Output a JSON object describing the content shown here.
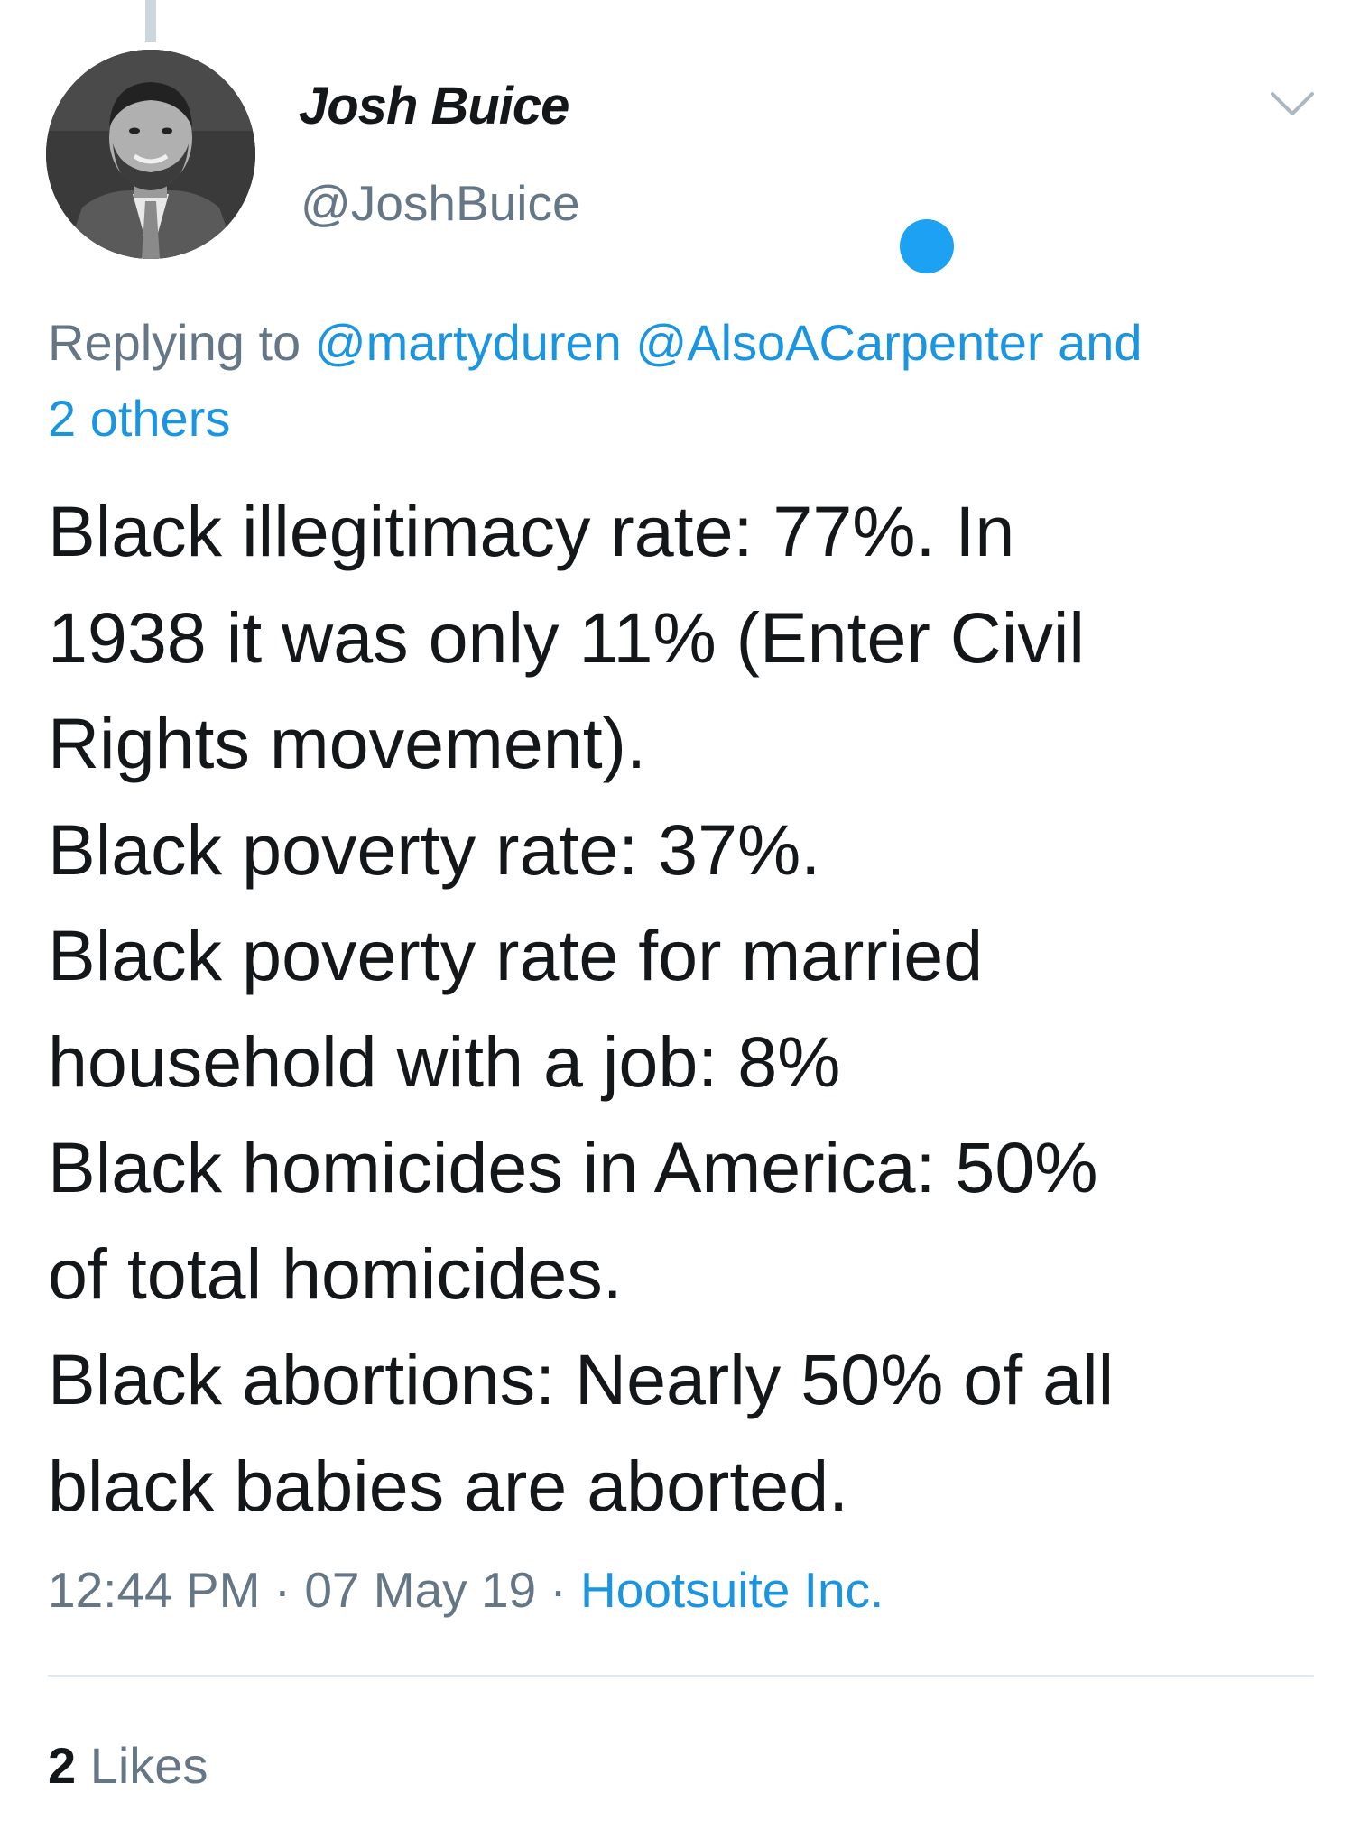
{
  "tweet": {
    "display_name": "Josh Buice",
    "handle": "@JoshBuice",
    "replying_to": {
      "prefix": "Replying to",
      "mentions": [
        "@martyduren",
        "@AlsoACarpenter"
      ],
      "and_label": "and",
      "others_label": "2 others"
    },
    "text_lines": [
      "Black illegitimacy rate: 77%. In",
      "1938 it was only 11% (Enter Civil",
      "Rights movement).",
      "Black poverty rate: 37%.",
      "Black poverty rate for married",
      "household with a job: 8%",
      "Black homicides in America: 50%",
      "of total homicides.",
      "Black abortions: Nearly 50% of all",
      "black babies are aborted."
    ],
    "time": "12:44 PM",
    "date": "07 May 19",
    "separator": "·",
    "source": "Hootsuite Inc.",
    "likes_count": "2",
    "likes_label": "Likes"
  },
  "icons": {
    "avatar": "profile-photo",
    "menu": "chevron-down-icon",
    "dot": "blue-dot"
  },
  "colors": {
    "accent": "#1da1f2",
    "link": "#1b95e0",
    "secondary_text": "#657786",
    "primary_text": "#14171a",
    "divider": "#e1e8ed"
  }
}
